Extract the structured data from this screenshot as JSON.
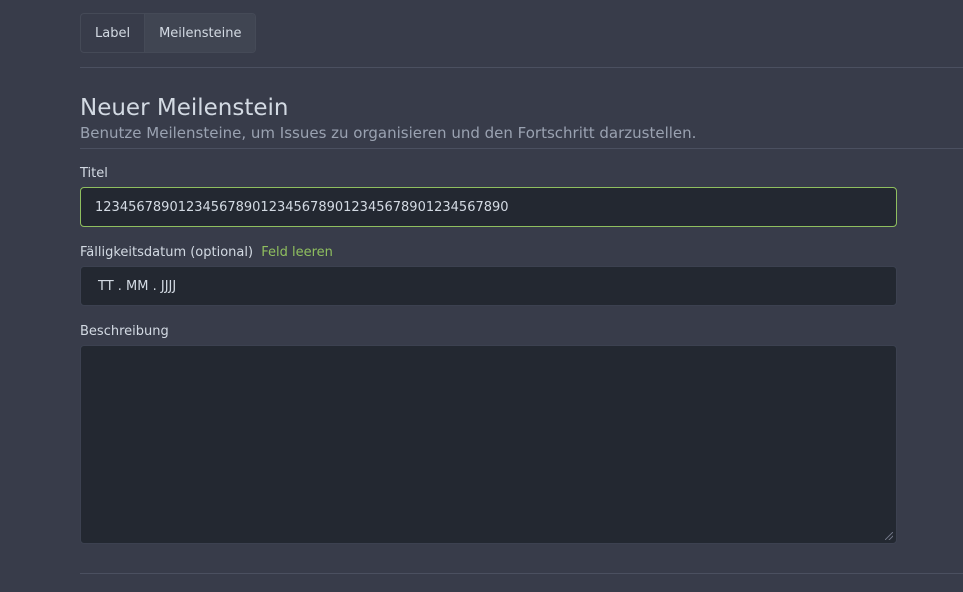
{
  "tabs": [
    {
      "label": "Label",
      "active": false
    },
    {
      "label": "Meilensteine",
      "active": true
    }
  ],
  "header": {
    "title": "Neuer Meilenstein",
    "subtitle": "Benutze Meilensteine, um Issues zu organisieren und den Fortschritt darzustellen."
  },
  "form": {
    "title_label": "Titel",
    "title_value": "12345678901234567890123456789012345678901234567890",
    "due_label": "Fälligkeitsdatum (optional)",
    "due_clear": "Feld leeren",
    "due_placeholder": "TT . MM . JJJJ",
    "desc_label": "Beschreibung",
    "desc_value": ""
  },
  "colors": {
    "background": "#383c4a",
    "input_background": "#232831",
    "accent": "#8fbf5f",
    "text": "#d3dae3",
    "muted_text": "#9aa2b1"
  }
}
